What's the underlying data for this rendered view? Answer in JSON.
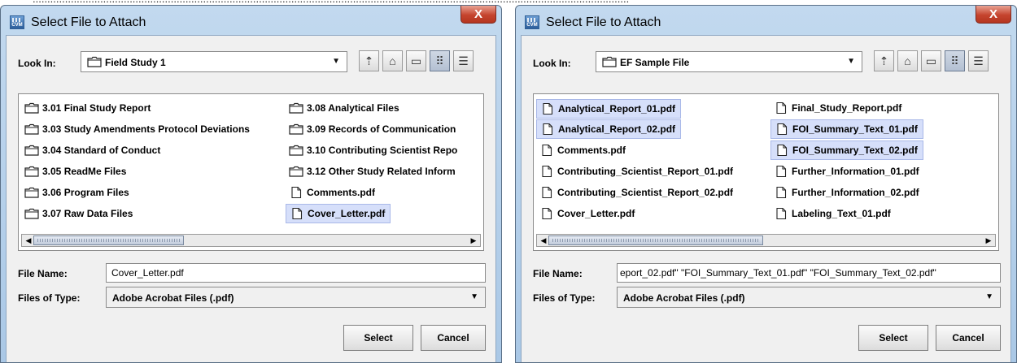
{
  "dialogs": [
    {
      "title": "Select File to Attach",
      "close_symbol": "X",
      "app_icon_text": "CVM",
      "look_in_label": "Look In:",
      "look_in_value": "Field Study 1",
      "toolbar_icons": [
        "up-folder-icon",
        "home-icon",
        "new-folder-icon",
        "list-view-icon",
        "details-view-icon"
      ],
      "items": [
        {
          "name": "3.01 Final Study Report",
          "kind": "folder",
          "selected": false
        },
        {
          "name": "3.03 Study Amendments Protocol Deviations",
          "kind": "folder",
          "selected": false
        },
        {
          "name": "3.04 Standard of Conduct",
          "kind": "folder",
          "selected": false
        },
        {
          "name": "3.05 ReadMe Files",
          "kind": "folder",
          "selected": false
        },
        {
          "name": "3.06 Program Files",
          "kind": "folder",
          "selected": false
        },
        {
          "name": "3.07 Raw Data Files",
          "kind": "folder",
          "selected": false
        },
        {
          "name": "3.08 Analytical Files",
          "kind": "folder",
          "selected": false
        },
        {
          "name": "3.09 Records of Communication",
          "kind": "folder",
          "selected": false
        },
        {
          "name": "3.10 Contributing Scientist Repo",
          "kind": "folder",
          "selected": false
        },
        {
          "name": "3.12 Other Study Related Inform",
          "kind": "folder",
          "selected": false
        },
        {
          "name": "Comments.pdf",
          "kind": "file",
          "selected": false
        },
        {
          "name": "Cover_Letter.pdf",
          "kind": "file",
          "selected": true
        }
      ],
      "file_name_label": "File Name:",
      "file_name_value": "Cover_Letter.pdf",
      "files_of_type_label": "Files of Type:",
      "files_of_type_value": "Adobe Acrobat Files (.pdf)",
      "select_label": "Select",
      "cancel_label": "Cancel"
    },
    {
      "title": "Select File to Attach",
      "close_symbol": "X",
      "app_icon_text": "CVM",
      "look_in_label": "Look In:",
      "look_in_value": "EF Sample File",
      "toolbar_icons": [
        "up-folder-icon",
        "home-icon",
        "new-folder-icon",
        "list-view-icon",
        "details-view-icon"
      ],
      "items": [
        {
          "name": "Analytical_Report_01.pdf",
          "kind": "file",
          "selected": true
        },
        {
          "name": "Analytical_Report_02.pdf",
          "kind": "file",
          "selected": true
        },
        {
          "name": "Comments.pdf",
          "kind": "file",
          "selected": false
        },
        {
          "name": "Contributing_Scientist_Report_01.pdf",
          "kind": "file",
          "selected": false
        },
        {
          "name": "Contributing_Scientist_Report_02.pdf",
          "kind": "file",
          "selected": false
        },
        {
          "name": "Cover_Letter.pdf",
          "kind": "file",
          "selected": false
        },
        {
          "name": "Final_Study_Report.pdf",
          "kind": "file",
          "selected": false
        },
        {
          "name": "FOI_Summary_Text_01.pdf",
          "kind": "file",
          "selected": true
        },
        {
          "name": "FOI_Summary_Text_02.pdf",
          "kind": "file",
          "selected": true
        },
        {
          "name": "Further_Information_01.pdf",
          "kind": "file",
          "selected": false
        },
        {
          "name": "Further_Information_02.pdf",
          "kind": "file",
          "selected": false
        },
        {
          "name": "Labeling_Text_01.pdf",
          "kind": "file",
          "selected": false
        }
      ],
      "file_name_label": "File Name:",
      "file_name_value": "eport_02.pdf\" \"FOI_Summary_Text_01.pdf\" \"FOI_Summary_Text_02.pdf\"",
      "files_of_type_label": "Files of Type:",
      "files_of_type_value": "Adobe Acrobat Files (.pdf)",
      "select_label": "Select",
      "cancel_label": "Cancel"
    }
  ],
  "colors": {
    "selection_bg": "#d6dffa",
    "selection_border": "#a9b8e8",
    "titlebar": "#b7d1ec",
    "close_button": "#c5442e"
  }
}
